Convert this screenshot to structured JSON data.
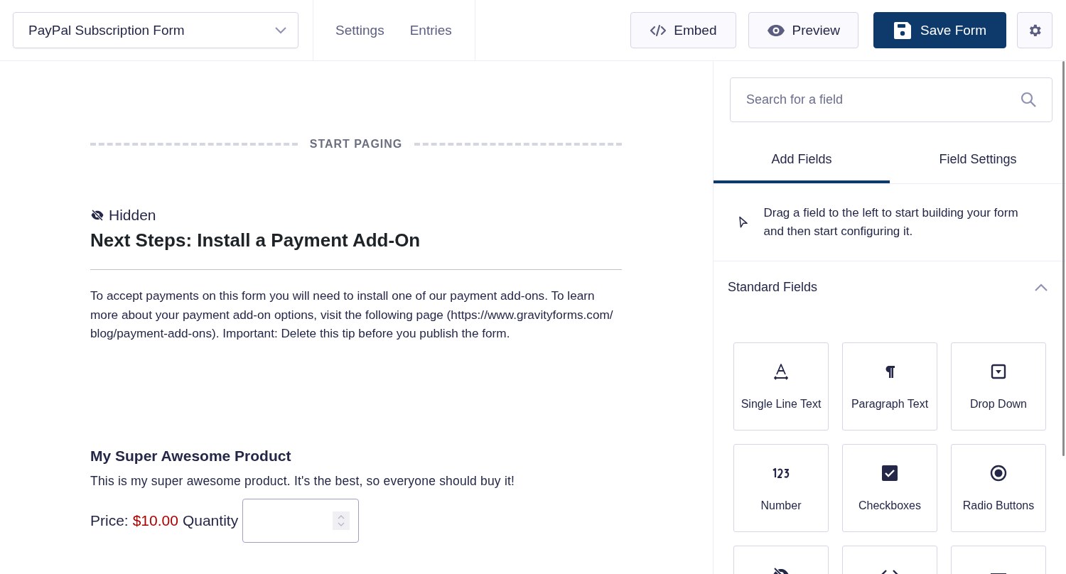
{
  "header": {
    "form_selector": {
      "value": "PayPal Subscription Form"
    },
    "nav": [
      {
        "label": "Settings"
      },
      {
        "label": "Entries"
      }
    ],
    "buttons": [
      {
        "kind": "embed",
        "label": "Embed"
      },
      {
        "kind": "preview",
        "label": "Preview"
      },
      {
        "kind": "save",
        "label": "Save Form"
      },
      {
        "kind": "settings"
      }
    ]
  },
  "canvas": {
    "page_break": {
      "label": "START PAGING"
    },
    "section": {
      "badge": "Hidden",
      "title": "Next Steps: Install a Payment Add-On",
      "text": "To accept payments on this form you will need to install one of our payment add-ons. To learn more about your payment add-on options, visit the following page (https://www.gravityforms.com/ blog/payment-add-ons). Important: Delete this tip before you publish the form."
    },
    "product": {
      "title": "My Super Awesome Product",
      "description": "This is my super awesome product. It's the best, so everyone should buy it!",
      "price_label": "Price:",
      "price": "$10.00",
      "quantity_label": "Quantity"
    }
  },
  "sidebar": {
    "search": {
      "placeholder": "Search for a field"
    },
    "tabs": [
      {
        "label": "Add Fields",
        "selected": true
      },
      {
        "label": "Field Settings",
        "selected": false
      }
    ],
    "hint": "Drag a field to the left to start building your form and then start configuring it.",
    "group": {
      "title": "Standard Fields",
      "expanded": true,
      "fields": [
        {
          "kind": "text",
          "label": "Single Line Text"
        },
        {
          "kind": "paragraph",
          "label": "Paragraph Text"
        },
        {
          "kind": "dropdown",
          "label": "Drop Down"
        },
        {
          "kind": "number",
          "label": "Number"
        },
        {
          "kind": "checkbox",
          "label": "Checkboxes"
        },
        {
          "kind": "radio",
          "label": "Radio Buttons"
        },
        {
          "kind": "hidden"
        },
        {
          "kind": "html"
        },
        {
          "kind": "section"
        }
      ]
    }
  }
}
